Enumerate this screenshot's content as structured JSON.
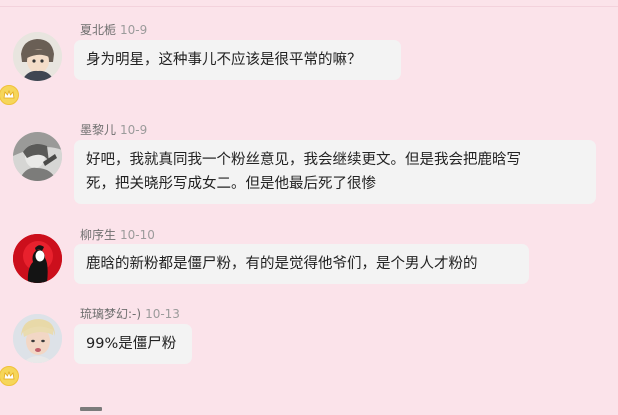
{
  "comments": [
    {
      "username": "夏北栀",
      "date": "10-9",
      "lines": [
        "身为明星，这种事儿不应该是很平常的嘛？"
      ],
      "avatar_icon": "anime-boy-avatar",
      "has_badge": true
    },
    {
      "username": "墨黎儿",
      "date": "10-9",
      "lines": [
        "好吧，我就真同我一个粉丝意见，我会继续更文。但是我会把鹿晗写",
        "死，把关晓彤写成女二。但是他最后死了很惨"
      ],
      "avatar_icon": "sketch-avatar",
      "has_badge": false
    },
    {
      "username": "柳序生",
      "date": "10-10",
      "lines": [
        "鹿晗的新粉都是僵尸粉，有的是觉得他爷们，是个男人才粉的"
      ],
      "avatar_icon": "red-silhouette-avatar",
      "has_badge": false
    },
    {
      "username": "琉璃梦幻:-)",
      "date": "10-13",
      "lines": [
        "99%是僵尸粉"
      ],
      "avatar_icon": "blonde-portrait-avatar",
      "has_badge": true
    }
  ],
  "badge_icon": "crown-icon",
  "colors": {
    "background": "#fbe3ea",
    "bubble": "#f3f3f3",
    "username": "#6f6f6f",
    "date": "#9b9b9b"
  }
}
